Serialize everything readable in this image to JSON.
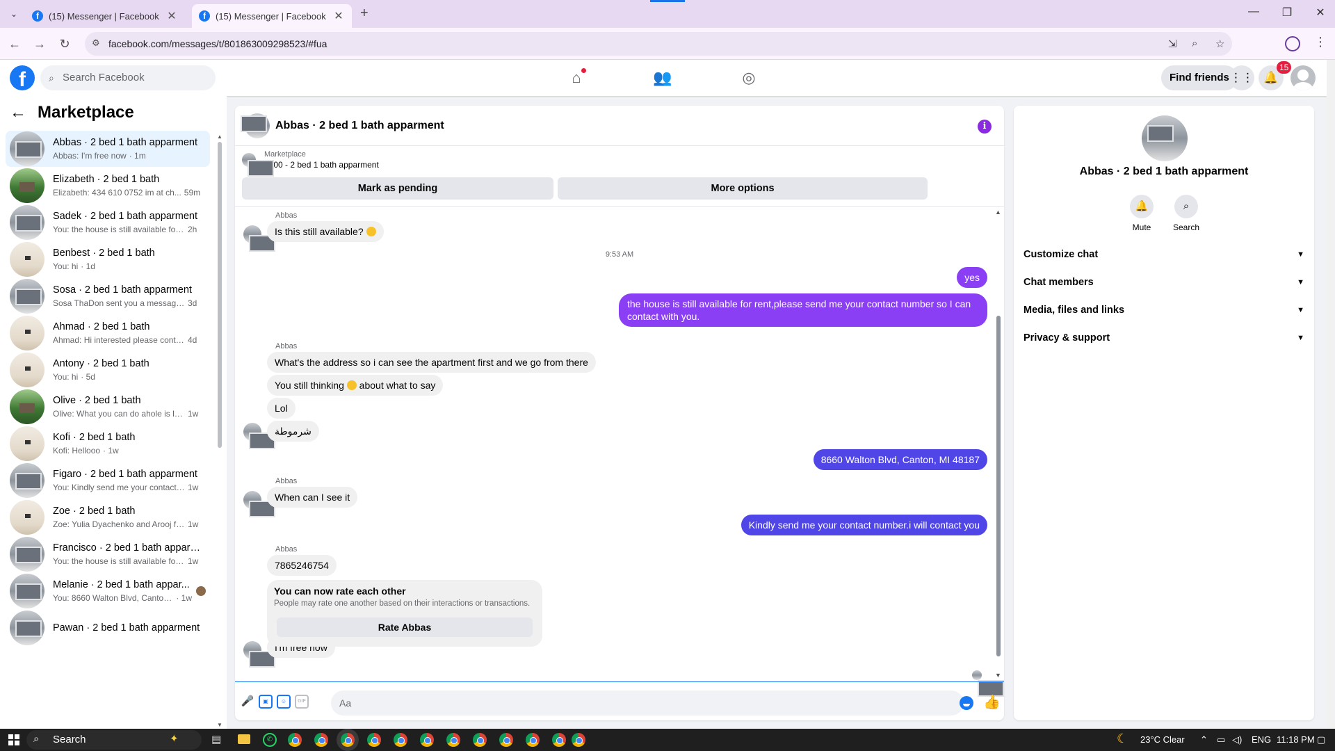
{
  "browser": {
    "tabs": [
      {
        "title": "(15) Messenger | Facebook",
        "close": "✕"
      },
      {
        "title": "(15) Messenger | Facebook",
        "close": "✕"
      }
    ],
    "new_tab": "+",
    "url": "facebook.com/messages/t/801863009298523/#fua",
    "window_controls": {
      "minimize": "—",
      "maximize": "❐",
      "close": "✕"
    }
  },
  "fb_header": {
    "logo": "f",
    "search_placeholder": "Search Facebook",
    "find_friends": "Find friends",
    "notification_count": "15",
    "brand_color": "#1877f2"
  },
  "sidebar": {
    "title": "Marketplace",
    "conversations": [
      {
        "name": "Abbas · 2 bed 1 bath apparment",
        "preview": "Abbas: I'm free now",
        "time": "· 1m",
        "thumb": "house",
        "active": true
      },
      {
        "name": "Elizabeth · 2 bed 1 bath",
        "preview": "Elizabeth: 434 610 0752 im at ch...",
        "time": "59m",
        "thumb": "green"
      },
      {
        "name": "Sadek · 2 bed 1 bath apparment",
        "preview": "You: the house is still available for r...",
        "time": "2h",
        "thumb": "house"
      },
      {
        "name": "Benbest · 2 bed 1 bath",
        "preview": "You: hi",
        "time": "· 1d",
        "thumb": "room"
      },
      {
        "name": "Sosa · 2 bed 1 bath apparment",
        "preview": "Sosa ThaDon sent you a message a...",
        "time": "3d",
        "thumb": "house"
      },
      {
        "name": "Ahmad · 2 bed 1 bath",
        "preview": "Ahmad: Hi interested please conta...",
        "time": "4d",
        "thumb": "room"
      },
      {
        "name": "Antony · 2 bed 1 bath",
        "preview": "You: hi",
        "time": "· 5d",
        "thumb": "room"
      },
      {
        "name": "Olive · 2 bed 1 bath",
        "preview": "Olive: What you can do ahole is le...",
        "time": "1w",
        "thumb": "green"
      },
      {
        "name": "Kofi · 2 bed 1 bath",
        "preview": "Kofi: Hellooo",
        "time": "· 1w",
        "thumb": "room"
      },
      {
        "name": "Figaro · 2 bed 1 bath apparment",
        "preview": "You: Kindly send me your contact ...",
        "time": "1w",
        "thumb": "house"
      },
      {
        "name": "Zoe · 2 bed 1 bath",
        "preview": "Zoe: Yulia Dyachenko and Arooj fa...",
        "time": "1w",
        "thumb": "room"
      },
      {
        "name": "Francisco · 2 bed 1 bath apparm...",
        "preview": "You: the house is still available for ...",
        "time": "1w",
        "thumb": "house"
      },
      {
        "name": "Melanie · 2 bed 1 bath appar...",
        "preview": "You: 8660 Walton Blvd, Canton, ...",
        "time": "· 1w",
        "thumb": "house"
      },
      {
        "name": "Pawan · 2 bed 1 bath apparment",
        "preview": "",
        "time": "",
        "thumb": "house"
      }
    ]
  },
  "chat": {
    "title": "Abbas · 2 bed 1 bath apparment",
    "listing_label": "Marketplace",
    "listing_detail": "$600 - 2 bed 1 bath apparment",
    "mark_pending": "Mark as pending",
    "more_options": "More options",
    "messages": {
      "sender_1": "Abbas",
      "m1": "Is this still available?",
      "time": "9:53 AM",
      "m2": "yes",
      "m3": "the house is still available for rent,please send me your contact number so I can contact with you.",
      "sender_2": "Abbas",
      "m4": "What's the address so i can see the apartment first and we go from there",
      "m5a": "You still thinking",
      "m5b": "about what to say",
      "m6": "Lol",
      "m7": "شرموطة",
      "m8": "8660 Walton Blvd, Canton, MI 48187",
      "sender_3": "Abbas",
      "m9": "When can I see it",
      "m10": "Kindly send me your contact number.i will contact you",
      "sender_4": "Abbas",
      "m11": "7865246754",
      "rate_title": "You can now rate each other",
      "rate_sub": "People may rate one another based on their interactions or transactions.",
      "rate_button": "Rate Abbas",
      "m12": "I'm free now"
    },
    "composer_placeholder": "Aa",
    "accent_color": "#8a3ff5"
  },
  "right_panel": {
    "name": "Abbas · 2 bed 1 bath apparment",
    "mute": "Mute",
    "search": "Search",
    "sections": [
      "Customize chat",
      "Chat members",
      "Media, files and links",
      "Privacy & support"
    ]
  },
  "taskbar": {
    "search": "Search",
    "weather": "23°C  Clear",
    "lang": "ENG",
    "time": "11:18 PM"
  }
}
